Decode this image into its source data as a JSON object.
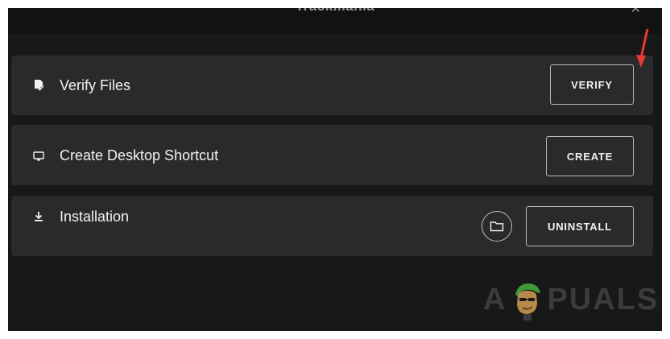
{
  "app": {
    "title": "Trackmania",
    "close_glyph": "✕"
  },
  "rows": {
    "verify": {
      "label": "Verify Files",
      "icon": "verify-file-icon",
      "button_label": "VERIFY"
    },
    "create": {
      "label": "Create Desktop Shortcut",
      "icon": "monitor-icon",
      "button_label": "CREATE"
    },
    "install": {
      "label": "Installation",
      "icon": "download-icon",
      "folder_icon": "folder-icon",
      "button_label": "UNINSTALL"
    }
  },
  "annotation": {
    "arrow_color": "#e53935",
    "icon": "red-arrow-icon"
  },
  "watermark": {
    "left": "A",
    "right": "PUALS",
    "icon": "appuals-mascot-icon"
  },
  "colors": {
    "background": "#121212",
    "row": "#2a2a2a",
    "text": "#f2f2f2",
    "border": "#bdbdbd"
  }
}
